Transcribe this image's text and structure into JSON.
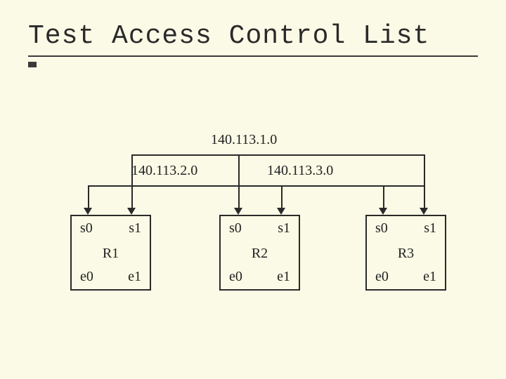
{
  "title": "Test Access Control List",
  "networks": {
    "top": "140.113.1.0",
    "left": "140.113.2.0",
    "right": "140.113.3.0"
  },
  "routers": [
    {
      "name": "R1",
      "ports": {
        "s0": "s0",
        "s1": "s1",
        "e0": "e0",
        "e1": "e1"
      }
    },
    {
      "name": "R2",
      "ports": {
        "s0": "s0",
        "s1": "s1",
        "e0": "e0",
        "e1": "e1"
      }
    },
    {
      "name": "R3",
      "ports": {
        "s0": "s0",
        "s1": "s1",
        "e0": "e0",
        "e1": "e1"
      }
    }
  ]
}
